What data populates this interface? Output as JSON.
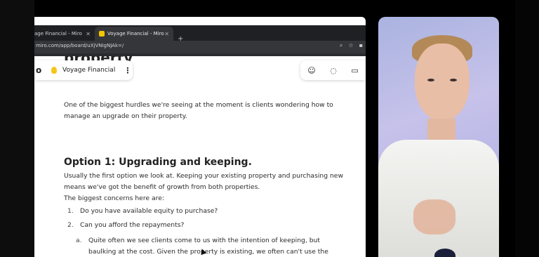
{
  "browser": {
    "tabs": [
      {
        "label": "age Financial - Miro"
      },
      {
        "label": "Voyage Financial - Miro"
      }
    ],
    "new_tab": "+",
    "url": "miro.com/app/board/uXjVNIgNJAk=/"
  },
  "miro": {
    "logo": "o",
    "board_name": "Voyage Financial",
    "menu": "⋮"
  },
  "doc": {
    "cut_heading": "property",
    "intro": "One of the biggest hurdles we're seeing at the moment is clients wondering how to manage an upgrade on their property.",
    "option_heading": "Option 1: Upgrading and keeping.",
    "option_text": "Usually the first option we look at. Keeping your existing property and purchasing new means we've got the benefit of growth from both properties.",
    "concerns_label": "The biggest concerns here are:",
    "list": [
      {
        "num": "1.",
        "text": "Do you have available equity to purchase?"
      },
      {
        "num": "2.",
        "text": "Can you afford the repayments?"
      }
    ],
    "sub": {
      "num": "a.",
      "text": "Quite often we see clients come to us with the intention of keeping, but baulking at the cost. Given the property is existing, we often can't use the plant and equipment depreciation that makes the tax deduction worth it."
    }
  }
}
